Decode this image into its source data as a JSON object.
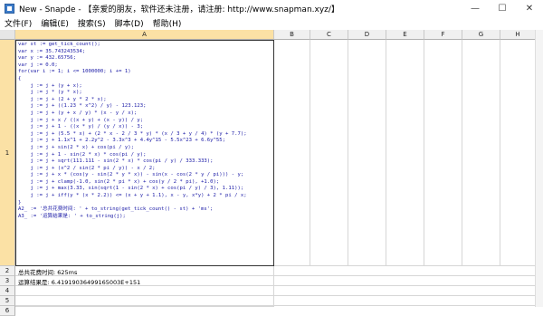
{
  "window": {
    "title": "New - Snapde - 【亲爱的朋友，软件还未注册，请注册: http://www.snapman.xyz/】",
    "minimize_glyph": "—",
    "maximize_glyph": "☐",
    "close_glyph": "✕"
  },
  "menu": [
    {
      "label": "文件(F)"
    },
    {
      "label": "编辑(E)"
    },
    {
      "label": "搜索(S)"
    },
    {
      "label": "脚本(D)"
    },
    {
      "label": "帮助(H)"
    }
  ],
  "columns": [
    "",
    "A",
    "B",
    "C",
    "D",
    "E",
    "F",
    "G",
    "H"
  ],
  "rows": [
    "1",
    "2",
    "3",
    "4",
    "5",
    "6"
  ],
  "cells": {
    "A1": "var st := get_tick_count();\nvar x := 35.743243534;\nvar y := 432.65756;\nvar j := 0.0;\nfor(var i := 1; i <= 1000000; i += 1)\n{\n    j := j + (y + x);\n    j := j * (y * x);\n    j := j + (2 + y * 2 * x);\n    j := j + ((1.23 * x^2) / y) - 123.123;\n    j := j + (y + x / y) * (x - y / x);\n    j := j + x / ((x + y) + (x - y)) / y;\n    j := j + 1 - ((x * y) / (y / x)) - 3;\n    j := j + (5.5 * x) + (2 * x - 2 / 3 * y) * (x / 3 + y / 4) * (y + 7.7);\n    j := j + 1.1x^1 + 2.2y^2 - 3.3x^3 + 4.4y^15 - 5.5x^23 + 6.6y^55;\n    j := j + sin(2 * x) + cos(pi / y);\n    j := j + 1 - sin(2 * x) * cos(pi / y);\n    j := j + sqrt(111.111 - sin(2 * x) * cos(pi / y) / 333.333);\n    j := j + (x^2 / sin(2 * pi / y)) - x / 2;\n    j := j + x * (cos(y - sin(2 * y * x)) - sin(x - cos(2 * y / pi))) - y;\n    j := j + clamp(-1.0, sin(2 * pi * x) + cos(y / 2 * pi), +1.0);\n    j := j + max(3.33, sin(sqrt(1 - sin(2 * x) + cos(pi / y) / 3), 1.11));\n    j := j + iff(y * (x * 2.2)) <= (x + y + 1.1), x - y, x*y) + 2 * pi / x;\n}\nA2_ := '总共花费时间: ' + to_string(get_tick_count() - st) + 'ms';\nA3_ := '运算结果是: ' + to_string(j);",
    "A2": "总共花费时间: 625ms",
    "A3": "运算结果是: 6.41919036499165003E+151"
  }
}
